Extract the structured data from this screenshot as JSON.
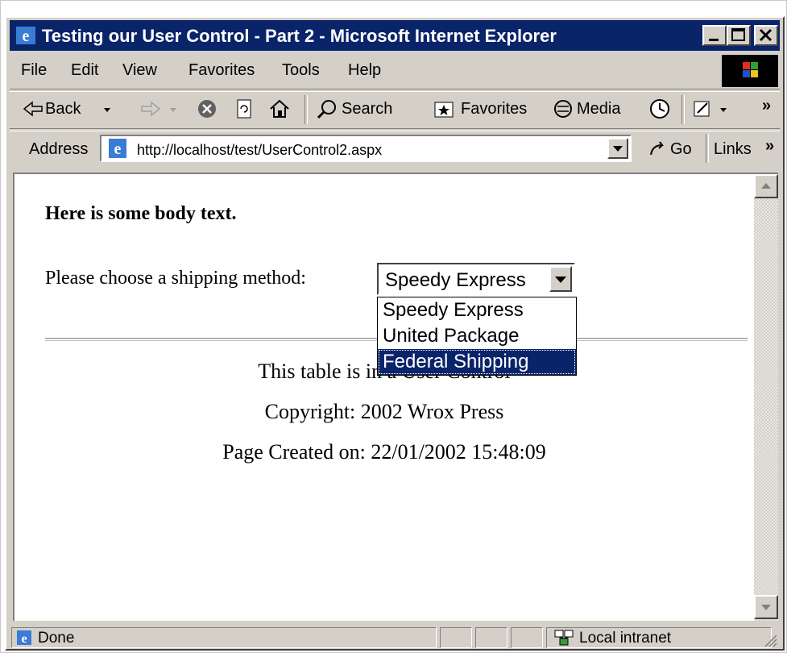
{
  "window": {
    "title": "Testing our User Control - Part 2 - Microsoft Internet Explorer",
    "caption_buttons": [
      "minimize-icon",
      "maximize-icon",
      "close-icon"
    ]
  },
  "menu": {
    "items": [
      {
        "label": "File"
      },
      {
        "label": "Edit"
      },
      {
        "label": "View"
      },
      {
        "label": "Favorites"
      },
      {
        "label": "Tools"
      },
      {
        "label": "Help"
      }
    ]
  },
  "toolbar": {
    "back_label": "Back",
    "search_label": "Search",
    "favorites_label": "Favorites",
    "media_label": "Media",
    "more": "»"
  },
  "address": {
    "label": "Address",
    "url": "http://localhost/test/UserControl2.aspx",
    "go_label": "Go",
    "links_label": "Links",
    "links_more": "»"
  },
  "page": {
    "heading": "Here is some body text.",
    "shipping_label": "Please choose a shipping method:",
    "shipping_select": {
      "selected": "Speedy Express",
      "options": [
        "Speedy Express",
        "United Package",
        "Federal Shipping"
      ],
      "highlighted": "Federal Shipping"
    },
    "user_control_text": "This table is in a User Control",
    "copyright": "Copyright: 2002 Wrox Press",
    "created": "Page Created on: 22/01/2002 15:48:09"
  },
  "status": {
    "text": "Done",
    "zone": "Local intranet"
  },
  "colors": {
    "titlebar": "#0a246a",
    "chrome": "#d4d0c8",
    "selection": "#0a246a"
  }
}
